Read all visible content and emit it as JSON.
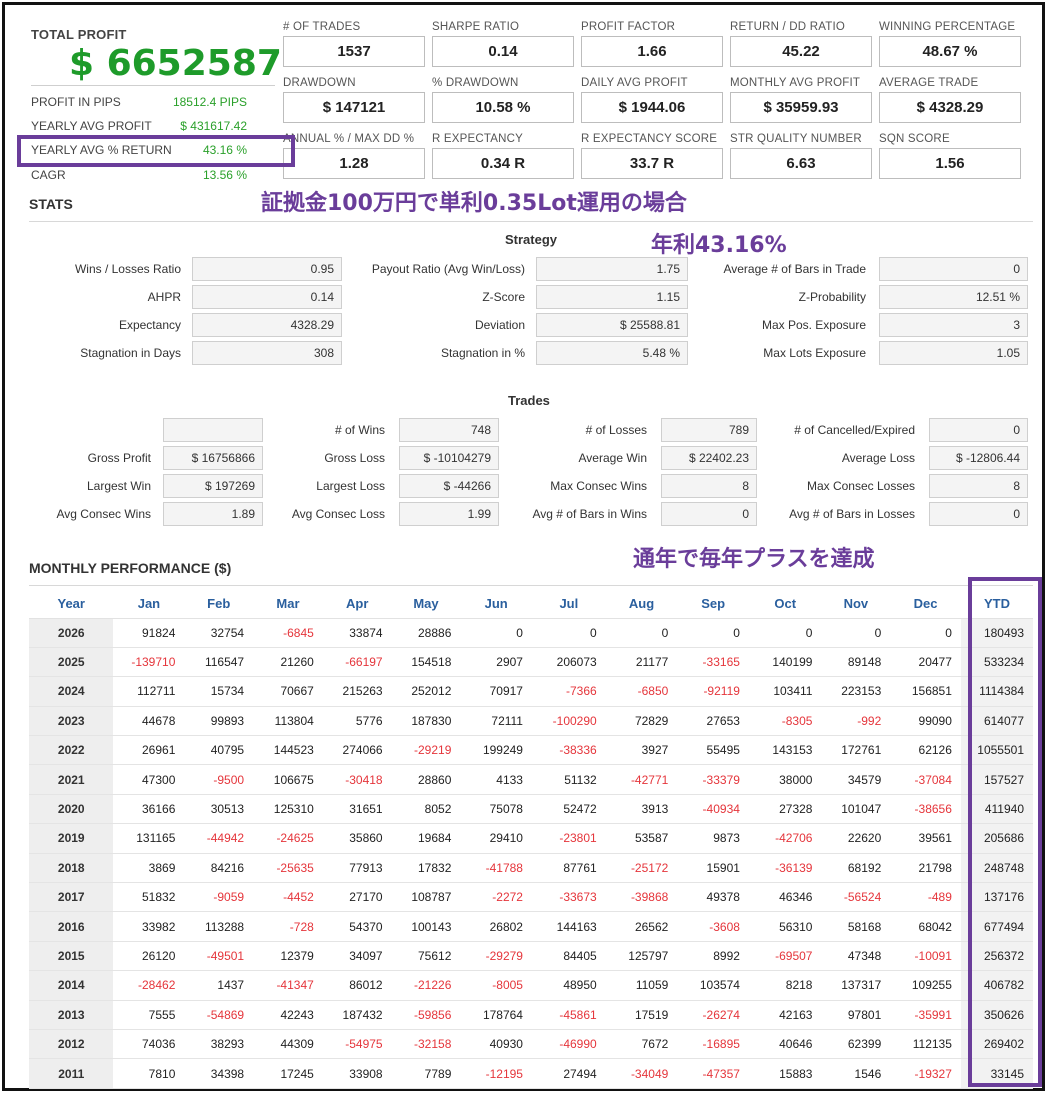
{
  "summary": {
    "total_profit_label": "TOTAL PROFIT",
    "total_profit_value": "$ 6652587",
    "rows": [
      {
        "label": "PROFIT IN PIPS",
        "value": "18512.4 PIPS"
      },
      {
        "label": "YEARLY AVG PROFIT",
        "value": "$ 431617.42"
      },
      {
        "label": "YEARLY AVG % RETURN",
        "value": "43.16 %"
      },
      {
        "label": "CAGR",
        "value": "13.56 %"
      }
    ]
  },
  "metrics": [
    {
      "label": "# OF TRADES",
      "value": "1537"
    },
    {
      "label": "SHARPE RATIO",
      "value": "0.14"
    },
    {
      "label": "PROFIT FACTOR",
      "value": "1.66"
    },
    {
      "label": "RETURN / DD RATIO",
      "value": "45.22"
    },
    {
      "label": "WINNING PERCENTAGE",
      "value": "48.67 %"
    },
    {
      "label": "DRAWDOWN",
      "value": "$ 147121"
    },
    {
      "label": "% DRAWDOWN",
      "value": "10.58 %"
    },
    {
      "label": "DAILY AVG PROFIT",
      "value": "$ 1944.06"
    },
    {
      "label": "MONTHLY AVG PROFIT",
      "value": "$ 35959.93"
    },
    {
      "label": "AVERAGE TRADE",
      "value": "$ 4328.29"
    },
    {
      "label": "ANNUAL % / MAX DD %",
      "value": "1.28"
    },
    {
      "label": "R EXPECTANCY",
      "value": "0.34 R"
    },
    {
      "label": "R EXPECTANCY SCORE",
      "value": "33.7 R"
    },
    {
      "label": "STR QUALITY NUMBER",
      "value": "6.63"
    },
    {
      "label": "SQN SCORE",
      "value": "1.56"
    }
  ],
  "annotations": {
    "margin_note": "証拠金100万円で単利0.35Lot運用の場合",
    "annual_note": "年利43.16%",
    "yearly_note": "通年で毎年プラスを達成"
  },
  "stats": {
    "title": "STATS",
    "strategy_title": "Strategy",
    "strategy_rows": [
      [
        {
          "label": "Wins / Losses Ratio",
          "value": "0.95"
        },
        {
          "label": "Payout Ratio (Avg Win/Loss)",
          "value": "1.75"
        },
        {
          "label": "Average # of Bars in Trade",
          "value": "0"
        }
      ],
      [
        {
          "label": "AHPR",
          "value": "0.14"
        },
        {
          "label": "Z-Score",
          "value": "1.15"
        },
        {
          "label": "Z-Probability",
          "value": "12.51 %"
        }
      ],
      [
        {
          "label": "Expectancy",
          "value": "4328.29"
        },
        {
          "label": "Deviation",
          "value": "$ 25588.81"
        },
        {
          "label": "Max Pos. Exposure",
          "value": "3"
        }
      ],
      [
        {
          "label": "Stagnation in Days",
          "value": "308"
        },
        {
          "label": "Stagnation in %",
          "value": "5.48 %"
        },
        {
          "label": "Max Lots Exposure",
          "value": "1.05"
        }
      ]
    ],
    "trades_title": "Trades",
    "trades_rows": [
      [
        {
          "label": "",
          "value": ""
        },
        {
          "label": "# of Wins",
          "value": "748"
        },
        {
          "label": "# of Losses",
          "value": "789"
        },
        {
          "label": "# of Cancelled/Expired",
          "value": "0"
        }
      ],
      [
        {
          "label": "Gross Profit",
          "value": "$ 16756866"
        },
        {
          "label": "Gross Loss",
          "value": "$ -10104279"
        },
        {
          "label": "Average Win",
          "value": "$ 22402.23"
        },
        {
          "label": "Average Loss",
          "value": "$ -12806.44"
        }
      ],
      [
        {
          "label": "Largest Win",
          "value": "$ 197269"
        },
        {
          "label": "Largest Loss",
          "value": "$ -44266"
        },
        {
          "label": "Max Consec Wins",
          "value": "8"
        },
        {
          "label": "Max Consec Losses",
          "value": "8"
        }
      ],
      [
        {
          "label": "Avg Consec Wins",
          "value": "1.89"
        },
        {
          "label": "Avg Consec Loss",
          "value": "1.99"
        },
        {
          "label": "Avg # of Bars in Wins",
          "value": "0"
        },
        {
          "label": "Avg # of Bars in Losses",
          "value": "0"
        }
      ]
    ]
  },
  "monthly": {
    "title": "MONTHLY PERFORMANCE ($)",
    "headers": [
      "Year",
      "Jan",
      "Feb",
      "Mar",
      "Apr",
      "May",
      "Jun",
      "Jul",
      "Aug",
      "Sep",
      "Oct",
      "Nov",
      "Dec",
      "YTD"
    ],
    "rows": [
      [
        "2026",
        "91824",
        "32754",
        "-6845",
        "33874",
        "28886",
        "0",
        "0",
        "0",
        "0",
        "0",
        "0",
        "0",
        "180493"
      ],
      [
        "2025",
        "-139710",
        "116547",
        "21260",
        "-66197",
        "154518",
        "2907",
        "206073",
        "21177",
        "-33165",
        "140199",
        "89148",
        "20477",
        "533234"
      ],
      [
        "2024",
        "112711",
        "15734",
        "70667",
        "215263",
        "252012",
        "70917",
        "-7366",
        "-6850",
        "-92119",
        "103411",
        "223153",
        "156851",
        "1114384"
      ],
      [
        "2023",
        "44678",
        "99893",
        "113804",
        "5776",
        "187830",
        "72111",
        "-100290",
        "72829",
        "27653",
        "-8305",
        "-992",
        "99090",
        "614077"
      ],
      [
        "2022",
        "26961",
        "40795",
        "144523",
        "274066",
        "-29219",
        "199249",
        "-38336",
        "3927",
        "55495",
        "143153",
        "172761",
        "62126",
        "1055501"
      ],
      [
        "2021",
        "47300",
        "-9500",
        "106675",
        "-30418",
        "28860",
        "4133",
        "51132",
        "-42771",
        "-33379",
        "38000",
        "34579",
        "-37084",
        "157527"
      ],
      [
        "2020",
        "36166",
        "30513",
        "125310",
        "31651",
        "8052",
        "75078",
        "52472",
        "3913",
        "-40934",
        "27328",
        "101047",
        "-38656",
        "411940"
      ],
      [
        "2019",
        "131165",
        "-44942",
        "-24625",
        "35860",
        "19684",
        "29410",
        "-23801",
        "53587",
        "9873",
        "-42706",
        "22620",
        "39561",
        "205686"
      ],
      [
        "2018",
        "3869",
        "84216",
        "-25635",
        "77913",
        "17832",
        "-41788",
        "87761",
        "-25172",
        "15901",
        "-36139",
        "68192",
        "21798",
        "248748"
      ],
      [
        "2017",
        "51832",
        "-9059",
        "-4452",
        "27170",
        "108787",
        "-2272",
        "-33673",
        "-39868",
        "49378",
        "46346",
        "-56524",
        "-489",
        "137176"
      ],
      [
        "2016",
        "33982",
        "113288",
        "-728",
        "54370",
        "100143",
        "26802",
        "144163",
        "26562",
        "-3608",
        "56310",
        "58168",
        "68042",
        "677494"
      ],
      [
        "2015",
        "26120",
        "-49501",
        "12379",
        "34097",
        "75612",
        "-29279",
        "84405",
        "125797",
        "8992",
        "-69507",
        "47348",
        "-10091",
        "256372"
      ],
      [
        "2014",
        "-28462",
        "1437",
        "-41347",
        "86012",
        "-21226",
        "-8005",
        "48950",
        "11059",
        "103574",
        "8218",
        "137317",
        "109255",
        "406782"
      ],
      [
        "2013",
        "7555",
        "-54869",
        "42243",
        "187432",
        "-59856",
        "178764",
        "-45861",
        "17519",
        "-26274",
        "42163",
        "97801",
        "-35991",
        "350626"
      ],
      [
        "2012",
        "74036",
        "38293",
        "44309",
        "-54975",
        "-32158",
        "40930",
        "-46990",
        "7672",
        "-16895",
        "40646",
        "62399",
        "112135",
        "269402"
      ],
      [
        "2011",
        "7810",
        "34398",
        "17245",
        "33908",
        "7789",
        "-12195",
        "27494",
        "-34049",
        "-47357",
        "15883",
        "1546",
        "-19327",
        "33145"
      ]
    ]
  },
  "colors": {
    "positive_green": "#1e9b2a",
    "negative_red": "#e5353b",
    "header_blue": "#2a5f9e",
    "annotation_purple": "#6a3d9a"
  }
}
